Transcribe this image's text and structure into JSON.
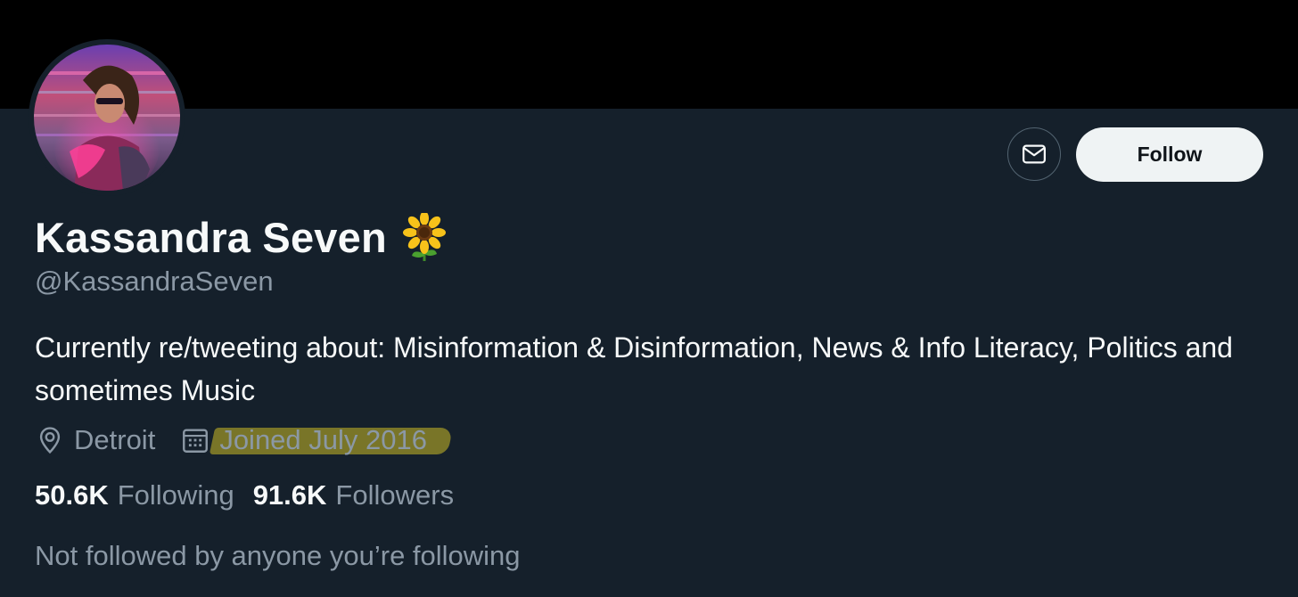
{
  "profile": {
    "display_name": "Kassandra Seven",
    "name_emoji_icon": "sunflower-icon",
    "handle": "@KassandraSeven",
    "bio": "Currently re/tweeting about: Misinformation & Disinformation, News & Info Literacy, Politics and sometimes Music",
    "location": "Detroit",
    "location_icon": "location-pin-icon",
    "joined": "Joined July 2016",
    "joined_icon": "calendar-icon",
    "joined_highlight_color": "#9b9128"
  },
  "actions": {
    "message_icon": "envelope-icon",
    "follow_label": "Follow"
  },
  "stats": {
    "following_count": "50.6K",
    "following_label": "Following",
    "followers_count": "91.6K",
    "followers_label": "Followers"
  },
  "social_context": "Not followed by anyone you’re following",
  "colors": {
    "background": "#15202b",
    "banner": "#000000",
    "primary_text": "#f7f9f9",
    "secondary_text": "#8b98a5",
    "follow_button_bg": "#eff3f4"
  }
}
